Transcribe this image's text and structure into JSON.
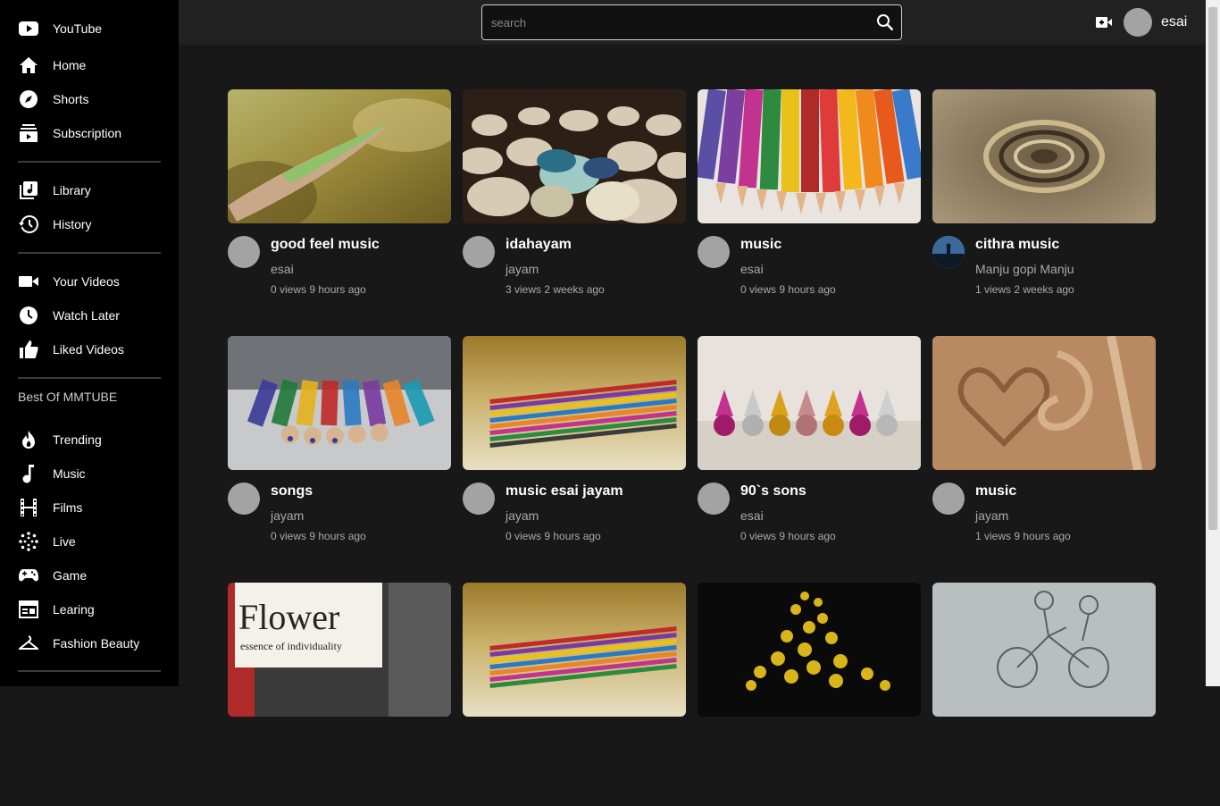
{
  "sidebar": {
    "brand": "YouTube",
    "items": [
      {
        "label": "Home",
        "icon": "home-icon"
      },
      {
        "label": "Shorts",
        "icon": "compass-icon"
      },
      {
        "label": "Subscription",
        "icon": "subscriptions-icon"
      },
      {
        "label": "Library",
        "icon": "library-icon"
      },
      {
        "label": "History",
        "icon": "history-icon"
      },
      {
        "label": "Your Videos",
        "icon": "video-camera-icon"
      },
      {
        "label": "Watch Later",
        "icon": "clock-icon"
      },
      {
        "label": "Liked Videos",
        "icon": "thumbs-up-icon"
      }
    ],
    "section_title": "Best Of MMTUBE",
    "best_of": [
      {
        "label": "Trending",
        "icon": "fire-icon"
      },
      {
        "label": "Music",
        "icon": "music-note-icon"
      },
      {
        "label": "Films",
        "icon": "film-icon"
      },
      {
        "label": "Live",
        "icon": "live-icon"
      },
      {
        "label": "Game",
        "icon": "gamepad-icon"
      },
      {
        "label": "Learing",
        "icon": "learning-icon"
      },
      {
        "label": "Fashion Beauty",
        "icon": "hanger-icon"
      }
    ]
  },
  "header": {
    "search_placeholder": "search",
    "username": "esai"
  },
  "videos": [
    {
      "title": "good feel music",
      "channel": "esai",
      "meta": "0 views 9 hours ago"
    },
    {
      "title": "idahayam",
      "channel": "jayam",
      "meta": "3 views 2 weeks ago"
    },
    {
      "title": "music",
      "channel": "esai",
      "meta": "0 views 9 hours ago"
    },
    {
      "title": "cithra music",
      "channel": "Manju gopi Manju",
      "meta": "1 views 2 weeks ago"
    },
    {
      "title": "songs",
      "channel": "jayam",
      "meta": "0 views 9 hours ago"
    },
    {
      "title": "music esai jayam",
      "channel": "jayam",
      "meta": "0 views 9 hours ago"
    },
    {
      "title": "90`s sons",
      "channel": "esai",
      "meta": "0 views 9 hours ago"
    },
    {
      "title": "music",
      "channel": "jayam",
      "meta": "1 views 9 hours ago"
    },
    {
      "title": "",
      "channel": "",
      "meta": ""
    },
    {
      "title": "",
      "channel": "",
      "meta": ""
    },
    {
      "title": "",
      "channel": "",
      "meta": ""
    },
    {
      "title": "",
      "channel": "",
      "meta": ""
    }
  ],
  "thumbnail_text": {
    "flower_title": "Flower",
    "flower_tagline": "essence of individuality"
  }
}
